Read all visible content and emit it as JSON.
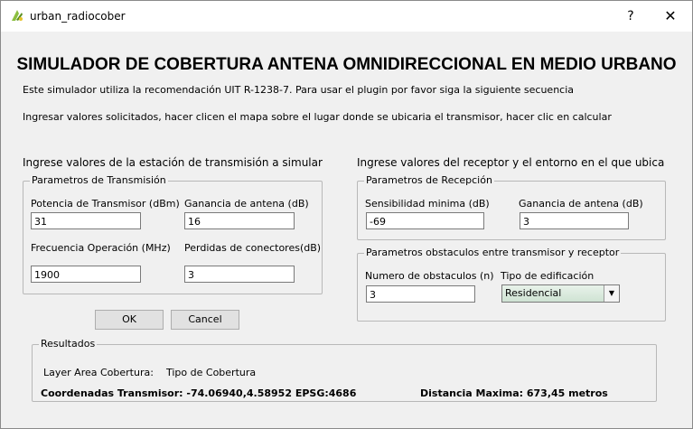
{
  "window": {
    "title": "urban_radiocober",
    "help_label": "?",
    "close_label": "✕",
    "app_icon": "qgis-icon"
  },
  "header": {
    "title": "SIMULADOR DE COBERTURA ANTENA OMNIDIRECCIONAL EN MEDIO URBANO",
    "intro": "Este simulador utiliza la recomendación UIT R-1238-7. Para usar el plugin por favor siga la siguiente secuencia",
    "instructions": "Ingresar valores solicitados,  hacer clicen el mapa sobre  el lugar donde se ubicaria el transmisor, hacer clic en calcular"
  },
  "transmitter": {
    "heading": "Ingrese valores de la estación de transmisión a simular",
    "group_title": "Parametros de Transmisión",
    "power_label": "Potencia de Transmisor (dBm)",
    "power_value": "31",
    "gain_label": "Ganancia de antena (dB)",
    "gain_value": "16",
    "freq_label": "Frecuencia Operación (MHz)",
    "freq_value": "1900",
    "loss_label": "Perdidas de conectores(dB)",
    "loss_value": "3"
  },
  "receiver": {
    "heading": "Ingrese valores del receptor y el entorno en el que ubica",
    "group_title": "Parametros de Recepción",
    "sens_label": "Sensibilidad minima (dB)",
    "sens_value": "-69",
    "gain_label": "Ganancia de antena (dB)",
    "gain_value": "3"
  },
  "obstacles": {
    "group_title": "Parametros obstaculos entre transmisor y receptor",
    "count_label": "Numero de obstaculos (n)",
    "count_value": "3",
    "building_label": "Tipo de edificación",
    "building_value": "Residencial"
  },
  "buttons": {
    "ok": "OK",
    "cancel": "Cancel"
  },
  "results": {
    "group_title": "Resultados",
    "layer_label": "Layer Area Cobertura:",
    "type_label": "Tipo de Cobertura",
    "coords": "Coordenadas Transmisor: -74.06940,4.58952  EPSG:4686",
    "distance": "Distancia Maxima: 673,45 metros"
  },
  "colors": {
    "select_bg": "#d6e8da",
    "window_bg": "#f0f0f0"
  }
}
